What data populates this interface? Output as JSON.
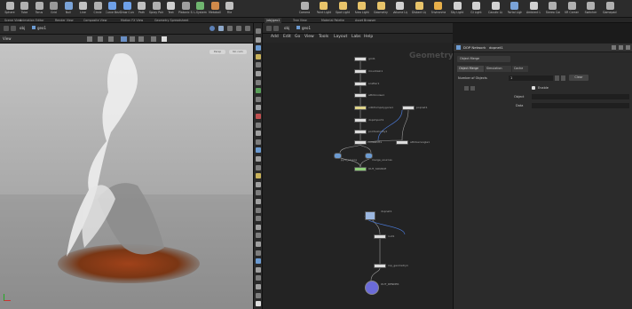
{
  "shelf": {
    "tools": [
      {
        "label": "Sphere",
        "icon": "sphere-icon",
        "color": "#b9b9b9"
      },
      {
        "label": "Tube",
        "icon": "tube-icon",
        "color": "#b0b0b0"
      },
      {
        "label": "Torus",
        "icon": "torus-icon",
        "color": "#b0b0b0"
      },
      {
        "label": "Grid",
        "icon": "grid-icon",
        "color": "#9a9a9a"
      },
      {
        "label": "Null",
        "icon": "null-icon",
        "color": "#7aa3d8"
      },
      {
        "label": "Line",
        "icon": "line-icon",
        "color": "#c0c0c0"
      },
      {
        "label": "Circle",
        "icon": "circle-icon",
        "color": "#b0b0b0"
      },
      {
        "label": "Curve Bezier",
        "icon": "curve-icon",
        "color": "#6ea0e8"
      },
      {
        "label": "Draw Curve",
        "icon": "draw-curve-icon",
        "color": "#6ea0e8"
      },
      {
        "label": "Path",
        "icon": "path-icon",
        "color": "#c0c0c0"
      },
      {
        "label": "Spray Paint",
        "icon": "spray-icon",
        "color": "#b0b0b0"
      },
      {
        "label": "Text",
        "icon": "text-icon",
        "color": "#d0d0d0"
      },
      {
        "label": "Platonic Solids",
        "icon": "platonic-icon",
        "color": "#a0a0a0"
      },
      {
        "label": "L-System",
        "icon": "lsystem-icon",
        "color": "#6fb56f"
      },
      {
        "label": "Metaball",
        "icon": "metaball-icon",
        "color": "#d08a4a"
      },
      {
        "label": "File",
        "icon": "file-icon",
        "color": "#c0c0c0"
      }
    ],
    "right_tools": [
      {
        "label": "Camera",
        "icon": "camera-icon",
        "color": "#b0b0b0"
      },
      {
        "label": "Point Light",
        "icon": "point-light-icon",
        "color": "#e8c46a"
      },
      {
        "label": "Spot Light",
        "icon": "spot-light-icon",
        "color": "#e8c46a"
      },
      {
        "label": "Area Light",
        "icon": "area-light-icon",
        "color": "#e8c46a"
      },
      {
        "label": "Geometry Light",
        "icon": "geometry-light-icon",
        "color": "#e8c46a"
      },
      {
        "label": "Volume Light",
        "icon": "volume-light-icon",
        "color": "#d2d2d2"
      },
      {
        "label": "Distant Light",
        "icon": "distant-light-icon",
        "color": "#e8c46a"
      },
      {
        "label": "Environment Light",
        "icon": "env-light-icon",
        "color": "#e8b04a"
      },
      {
        "label": "Sky Light",
        "icon": "sky-light-icon",
        "color": "#d2d2d2"
      },
      {
        "label": "GI Light",
        "icon": "gi-light-icon",
        "color": "#d2d2d2"
      },
      {
        "label": "Caustic Light",
        "icon": "caustic-light-icon",
        "color": "#d2d2d2"
      },
      {
        "label": "Portal Light",
        "icon": "portal-light-icon",
        "color": "#7aa3d8"
      },
      {
        "label": "Ambient Light",
        "icon": "ambient-light-icon",
        "color": "#d2d2d2"
      },
      {
        "label": "Stereo Camera",
        "icon": "stereo-camera-icon",
        "color": "#b0b0b0"
      },
      {
        "label": "VR Camera",
        "icon": "vr-camera-icon",
        "color": "#b0b0b0"
      },
      {
        "label": "Switcher",
        "icon": "switcher-icon",
        "color": "#b0b0b0"
      },
      {
        "label": "Gamepad Camera",
        "icon": "gamepad-icon",
        "color": "#b0b0b0"
      }
    ]
  },
  "left_tabs": [
    "Scene View",
    "Animation Editor",
    "Render View",
    "Composite View",
    "Motion FX View",
    "Geometry Spreadsheet"
  ],
  "right_tabs": [
    "/obj/geo1",
    "Tree View",
    "Material Palette",
    "Asset Browser"
  ],
  "viewport": {
    "path": "obj",
    "node": "geo1",
    "label_view": "View",
    "camera_label": "Persp",
    "cam_menu": "No cam"
  },
  "network": {
    "path": "obj",
    "node": "geo1",
    "menu": [
      "Add",
      "Edit",
      "Go",
      "View",
      "Tools",
      "Layout",
      "Labs",
      "Help"
    ],
    "watermark": "Geometry",
    "nodes": [
      {
        "name": "grid1",
        "color": "#dcdcdc"
      },
      {
        "name": "mountain1",
        "color": "#dcdcdc"
      },
      {
        "name": "scatter1",
        "color": "#dcdcdc"
      },
      {
        "name": "attribnoise1",
        "color": "#dcdcdc"
      },
      {
        "name": "vdbfrompolygons1",
        "color": "#e0d58a"
      },
      {
        "name": "popnet1",
        "color": "#dcdcdc"
      },
      {
        "name": "dopimport1",
        "color": "#dcdcdc"
      },
      {
        "name": "pointvelocity1",
        "color": "#dcdcdc"
      },
      {
        "name": "timeshift1",
        "color": "#dcdcdc"
      },
      {
        "name": "attribwrangle1",
        "color": "#dcdcdc"
      },
      {
        "name": "pyro_source",
        "color": "#dcdcdc"
      },
      {
        "name": "merge_sources",
        "color": "#dcdcdc"
      },
      {
        "name": "OUT_SOURCE",
        "color": "#8fce7a"
      },
      {
        "name": "dopnet1",
        "color": "#9bb7e0"
      },
      {
        "name": "null1",
        "color": "#dcdcdc"
      },
      {
        "name": "rop_geometry1",
        "color": "#dcdcdc"
      },
      {
        "name": "OUT_RENDER",
        "color": "#6b6bd8"
      }
    ]
  },
  "params": {
    "type": "DOP Network",
    "name": "dopnet1",
    "tabs": [
      "Object Merge",
      "Simulation",
      "Cache"
    ],
    "sub_tabs": [
      "Object Merge",
      "Simulation",
      "Cache"
    ],
    "fields": [
      {
        "label": "Number of Objects",
        "value": "1"
      },
      {
        "label": "Object",
        "value": ""
      },
      {
        "label": "Data",
        "value": ""
      }
    ],
    "enable_label": "Enable",
    "clear_button": "Clear"
  }
}
